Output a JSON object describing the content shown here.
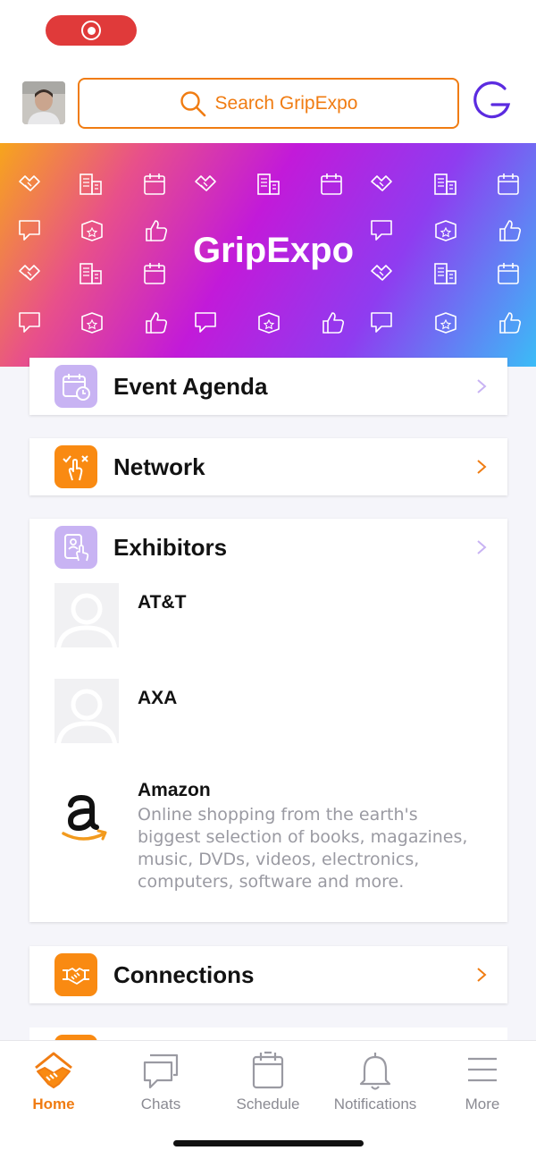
{
  "status": {
    "recording": true
  },
  "header": {
    "search_placeholder": "Search GripExpo",
    "brand_letter": "G"
  },
  "banner": {
    "title": "GripExpo"
  },
  "menu": {
    "event_agenda": "Event Agenda",
    "network": "Network",
    "exhibitors": "Exhibitors",
    "connections": "Connections"
  },
  "exhibitors": [
    {
      "name": "AT&T",
      "description": ""
    },
    {
      "name": "AXA",
      "description": ""
    },
    {
      "name": "Amazon",
      "description": "Online shopping from the earth's biggest selection of books, magazines, music, DVDs, videos, electronics, computers, software and more."
    }
  ],
  "tabbar": {
    "home": "Home",
    "chats": "Chats",
    "schedule": "Schedule",
    "notifications": "Notifications",
    "more": "More"
  },
  "colors": {
    "accent": "#f07c12",
    "brand_purple": "#5b2be0",
    "lilac_tile": "#c8b3f3",
    "orange_tile": "#f98a12"
  }
}
